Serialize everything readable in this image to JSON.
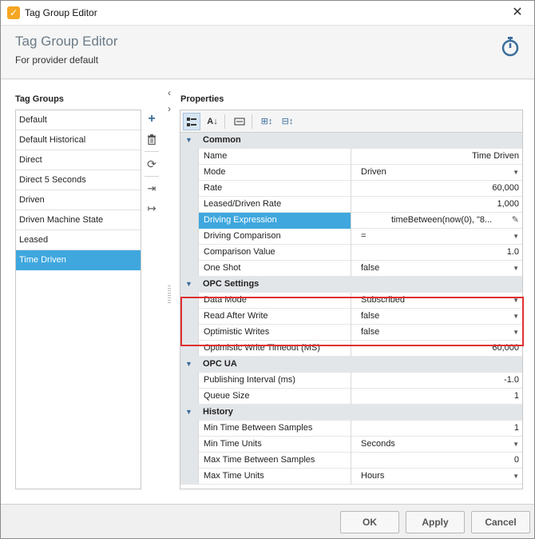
{
  "window": {
    "title": "Tag Group Editor",
    "close_glyph": "✕"
  },
  "header": {
    "title": "Tag Group Editor",
    "subtitle": "For provider default",
    "icon": "stopwatch-icon"
  },
  "tag_groups": {
    "label": "Tag Groups",
    "items": [
      {
        "label": "Default",
        "selected": false
      },
      {
        "label": "Default Historical",
        "selected": false
      },
      {
        "label": "Direct",
        "selected": false
      },
      {
        "label": "Direct 5 Seconds",
        "selected": false
      },
      {
        "label": "Driven",
        "selected": false
      },
      {
        "label": "Driven Machine State",
        "selected": false
      },
      {
        "label": "Leased",
        "selected": false
      },
      {
        "label": "Time Driven",
        "selected": true
      }
    ],
    "tools": [
      "add-icon",
      "delete-icon",
      "refresh-icon",
      "import-icon",
      "export-icon"
    ]
  },
  "properties": {
    "label": "Properties",
    "toolbar": [
      "categorized-icon",
      "sort-alpha-icon",
      "property-pages-icon",
      "expand-all-icon",
      "collapse-all-icon"
    ],
    "categories": [
      {
        "name": "Common",
        "rows": [
          {
            "name": "Name",
            "value": "Time Driven",
            "align": "right",
            "dropdown": false
          },
          {
            "name": "Mode",
            "value": "Driven",
            "align": "left",
            "dropdown": true
          },
          {
            "name": "Rate",
            "value": "60,000",
            "align": "right",
            "dropdown": false
          },
          {
            "name": "Leased/Driven Rate",
            "value": "1,000",
            "align": "right",
            "dropdown": false
          },
          {
            "name": "Driving Expression",
            "value": "timeBetween(now(0), \"8...",
            "align": "left",
            "dropdown": false,
            "selected": true,
            "editor": true
          },
          {
            "name": "Driving Comparison",
            "value": "=",
            "align": "left",
            "dropdown": true
          },
          {
            "name": "Comparison Value",
            "value": "1.0",
            "align": "right",
            "dropdown": false
          },
          {
            "name": "One Shot",
            "value": "false",
            "align": "left",
            "dropdown": true
          }
        ]
      },
      {
        "name": "OPC Settings",
        "rows": [
          {
            "name": "Data Mode",
            "value": "Subscribed",
            "align": "left",
            "dropdown": true
          },
          {
            "name": "Read After Write",
            "value": "false",
            "align": "left",
            "dropdown": true
          },
          {
            "name": "Optimistic Writes",
            "value": "false",
            "align": "left",
            "dropdown": true
          },
          {
            "name": "Optimistic Write Timeout (MS)",
            "value": "60,000",
            "align": "right",
            "dropdown": false
          }
        ]
      },
      {
        "name": "OPC UA",
        "rows": [
          {
            "name": "Publishing Interval (ms)",
            "value": "-1.0",
            "align": "right",
            "dropdown": false
          },
          {
            "name": "Queue Size",
            "value": "1",
            "align": "right",
            "dropdown": false
          }
        ]
      },
      {
        "name": "History",
        "rows": [
          {
            "name": "Min Time Between Samples",
            "value": "1",
            "align": "right",
            "dropdown": false
          },
          {
            "name": "Min Time Units",
            "value": "Seconds",
            "align": "left",
            "dropdown": true
          },
          {
            "name": "Max Time Between Samples",
            "value": "0",
            "align": "right",
            "dropdown": false
          },
          {
            "name": "Max Time Units",
            "value": "Hours",
            "align": "left",
            "dropdown": true
          }
        ]
      }
    ]
  },
  "footer": {
    "ok_label": "OK",
    "apply_label": "Apply",
    "cancel_label": "Cancel"
  },
  "colors": {
    "selection": "#3fa7de",
    "highlight_border": "#e03030",
    "header_title": "#6b7b86"
  }
}
